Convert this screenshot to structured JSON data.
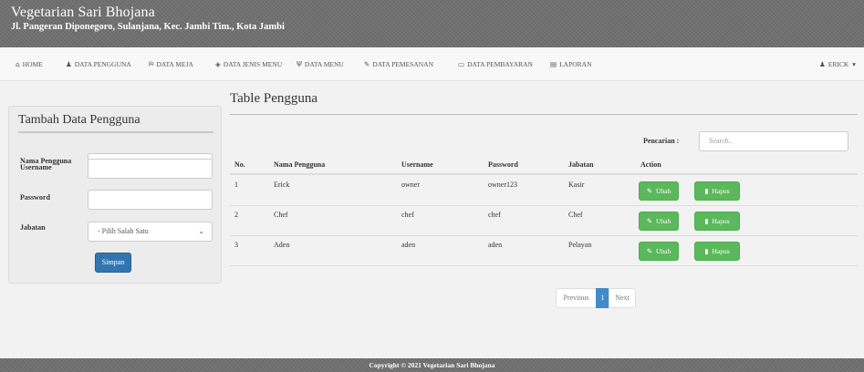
{
  "header": {
    "title": "Vegetarian Sari Bhojana",
    "address": "Jl. Pangeran Diponegoro, Sulanjana, Kec. Jambi Tim., Kota Jambi"
  },
  "nav": {
    "home": {
      "icon": "home-icon",
      "glyph": "⌂",
      "label": "HOME"
    },
    "pengguna": {
      "icon": "user-icon",
      "glyph": "♟",
      "label": "DATA PENGGUNA"
    },
    "meja": {
      "icon": "tag-icon",
      "glyph": "⛿",
      "label": "DATA MEJA"
    },
    "jenis_menu": {
      "icon": "tag-icon",
      "glyph": "◈",
      "label": "DATA JENIS MENU"
    },
    "menu": {
      "icon": "cutlery-icon",
      "glyph": "ψ",
      "label": "DATA MENU"
    },
    "pemesanan": {
      "icon": "pencil-icon",
      "glyph": "✎",
      "label": "DATA PEMESANAN"
    },
    "pembayaran": {
      "icon": "money-icon",
      "glyph": "▭",
      "label": "DATA PEMBAYARAN"
    },
    "laporan": {
      "icon": "document-icon",
      "glyph": "▤",
      "label": "LAPORAN"
    },
    "user": {
      "icon": "user-icon",
      "glyph": "♟",
      "label": "ERICK",
      "caret": "▾"
    }
  },
  "form": {
    "title": "Tambah Data Pengguna",
    "nama_label": "Nama Pengguna",
    "username_label": "Username",
    "password_label": "Password",
    "jabatan_label": "Jabatan",
    "jabatan_selected": "- Pilih Salah Satu",
    "select_caret": "⌄",
    "submit_label": "Simpan"
  },
  "table": {
    "title": "Table Pengguna",
    "search_label": "Pencarian :",
    "search_placeholder": "Search..",
    "columns": {
      "no": "No.",
      "nama": "Nama Pengguna",
      "username": "Username",
      "password": "Password",
      "jabatan": "Jabatan",
      "action": "Action"
    },
    "rows": [
      {
        "no": "1",
        "nama": "Erick",
        "username": "owner",
        "password": "owner123",
        "jabatan": "Kasir"
      },
      {
        "no": "2",
        "nama": "Chef",
        "username": "chef",
        "password": "chef",
        "jabatan": "Chef"
      },
      {
        "no": "3",
        "nama": "Aden",
        "username": "aden",
        "password": "aden",
        "jabatan": "Pelayan"
      }
    ],
    "edit_label": "Ubah",
    "edit_glyph": "✎",
    "delete_label": "Hapus",
    "delete_glyph": "▮"
  },
  "pagination": {
    "previous": "Previous",
    "current": "1",
    "next": "Next"
  },
  "footer": {
    "text": "Copyright © 2021 Vegetarian Sari Bhojana"
  },
  "colors": {
    "header_bg": "#707070",
    "primary": "#3276b1",
    "success": "#5cb85c",
    "page_active": "#428bca"
  }
}
